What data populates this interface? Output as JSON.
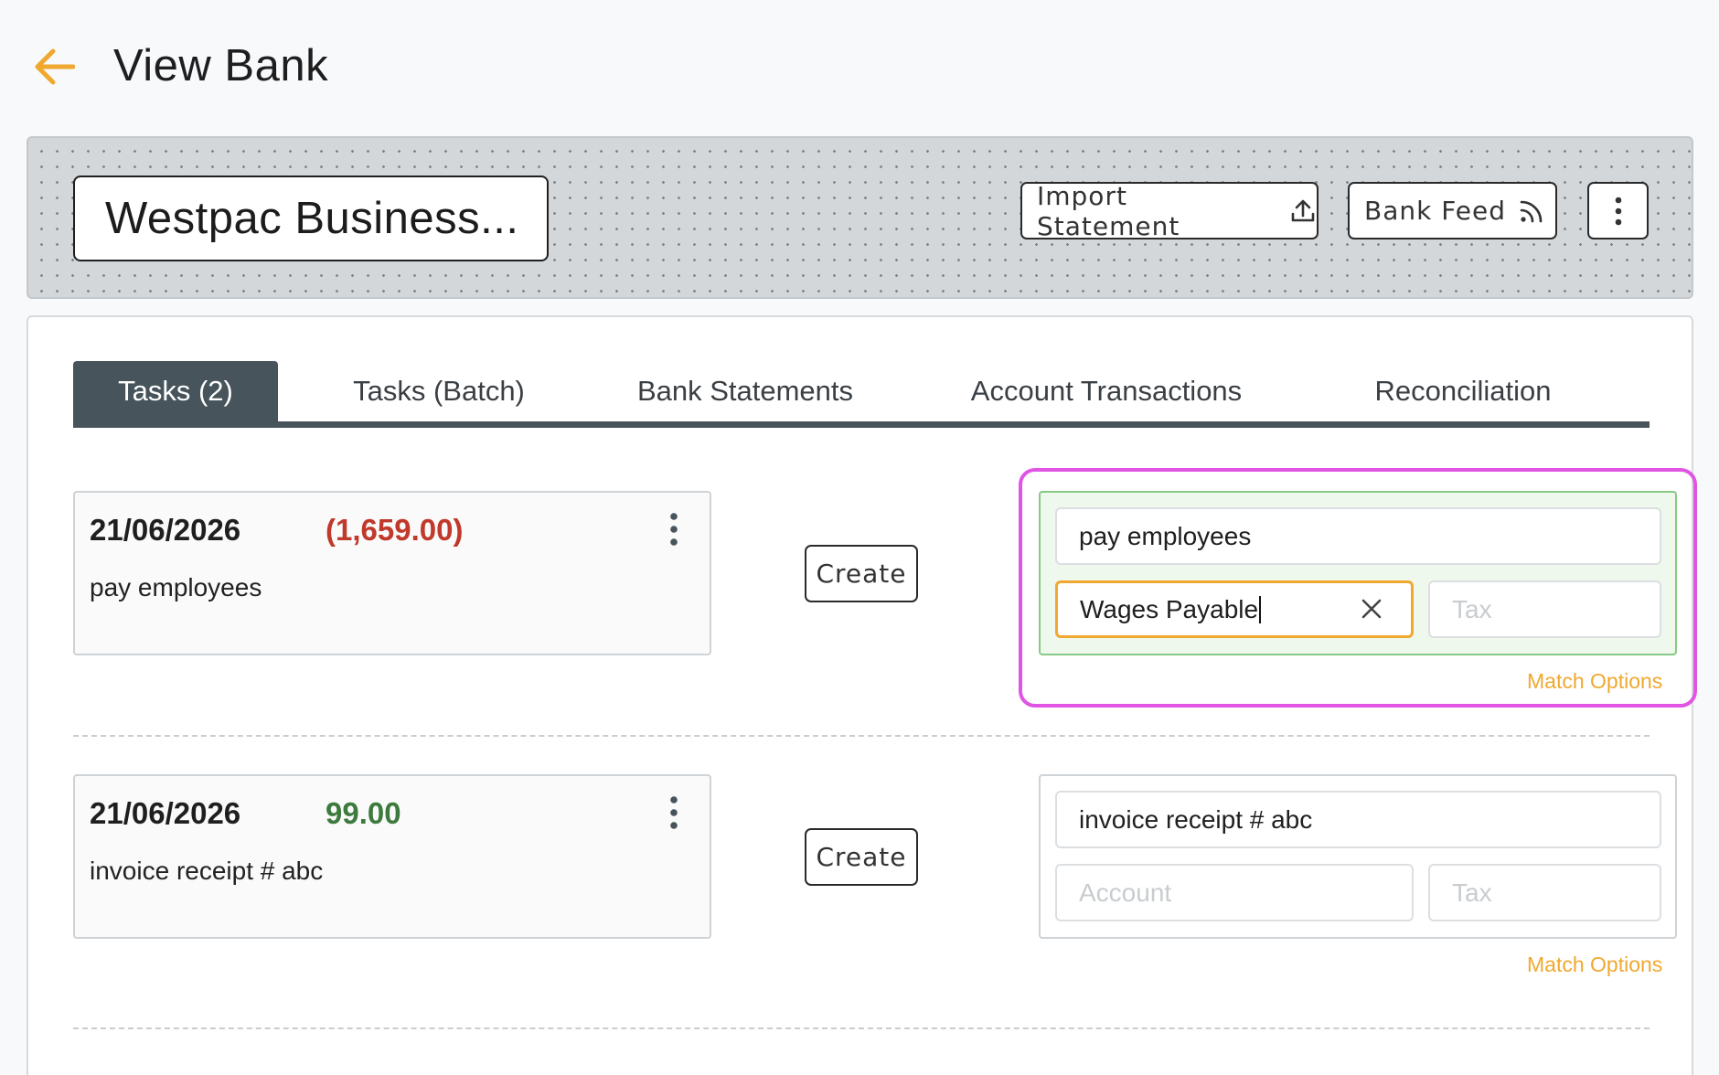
{
  "header": {
    "title": "View Bank",
    "back_icon": "arrow-left-icon"
  },
  "banner": {
    "bank_name": "Westpac Business...",
    "import_label": "Import Statement",
    "import_icon": "upload-icon",
    "feed_label": "Bank Feed",
    "feed_icon": "rss-feed-icon",
    "more_icon": "more-vertical-icon"
  },
  "tabs": [
    {
      "label": "Tasks (2)",
      "active": true
    },
    {
      "label": "Tasks (Batch)",
      "active": false
    },
    {
      "label": "Bank Statements",
      "active": false
    },
    {
      "label": "Account Transactions",
      "active": false
    },
    {
      "label": "Reconciliation",
      "active": false
    }
  ],
  "tasks": [
    {
      "date": "21/06/2026",
      "amount": "(1,659.00)",
      "amount_type": "negative",
      "description": "pay employees",
      "create_label": "Create",
      "match": {
        "description_value": "pay employees",
        "account_value": "Wages Payable",
        "account_placeholder": "Account",
        "tax_placeholder": "Tax",
        "match_options_label": "Match Options",
        "matched": true
      }
    },
    {
      "date": "21/06/2026",
      "amount": "99.00",
      "amount_type": "positive",
      "description": "invoice receipt # abc",
      "create_label": "Create",
      "match": {
        "description_value": "invoice receipt # abc",
        "account_value": "",
        "account_placeholder": "Account",
        "tax_placeholder": "Tax",
        "match_options_label": "Match Options",
        "matched": false
      }
    }
  ],
  "colors": {
    "accent_orange": "#f0a830",
    "tab_active": "#47545c",
    "negative": "#c0392b",
    "positive": "#3d7a3d",
    "highlight": "#e155e5"
  }
}
